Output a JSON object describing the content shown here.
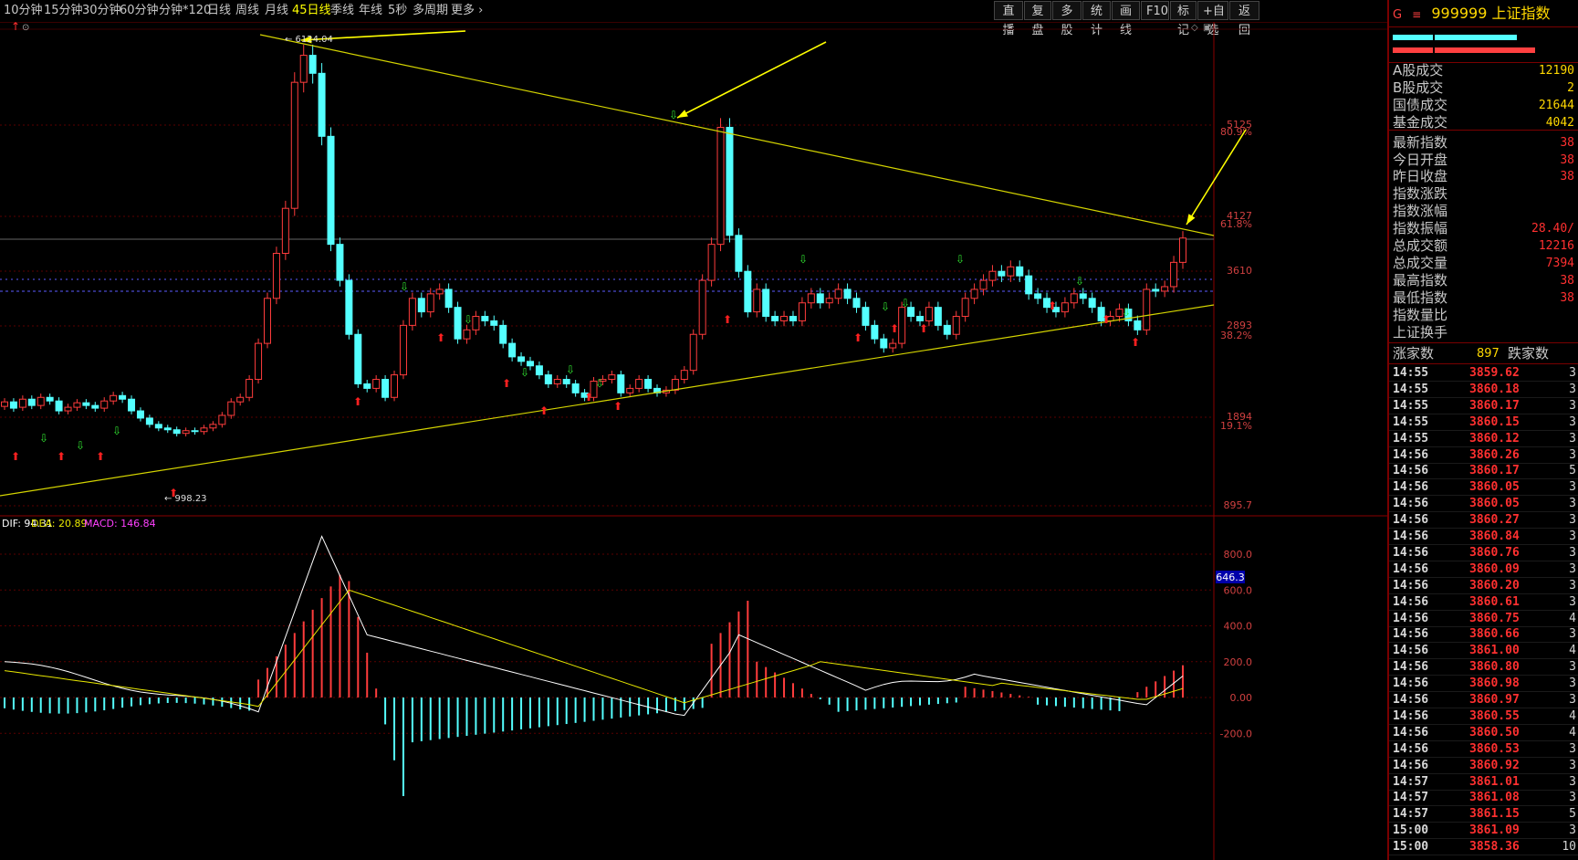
{
  "toolbar": {
    "periods": [
      "10分钟",
      "15分钟",
      "30分钟",
      "60分钟",
      "分钟*120",
      "日线",
      "周线",
      "月线",
      "45日线",
      "季线",
      "年线",
      "5秒",
      "多周期",
      "更多"
    ],
    "active_period": "45日线",
    "right_buttons": [
      "直播",
      "复盘",
      "多股",
      "统计",
      "画线",
      "F10",
      "标记",
      "+自选",
      "返回"
    ]
  },
  "chart": {
    "high_label": "6124.04",
    "low_label": "998.23",
    "price_axis": [
      "5125",
      "4127",
      "3610",
      "2893",
      "1894",
      "895.7"
    ],
    "pct_axis": [
      "80.9%",
      "61.8%",
      "38.2%",
      "19.1%"
    ],
    "macd_header": {
      "dif": "94.31",
      "dea_label": "DEA: 20.89",
      "macd_label": "MACD: 146.84"
    },
    "macd_axis": [
      "800.0",
      "600.0",
      "400.0",
      "200.0",
      "0.00",
      "-200.0"
    ],
    "macd_current": "646.3",
    "colors": {
      "up": "#ff3c3c",
      "down": "#54ffff",
      "trend": "#d4d400",
      "arrow": "#ffff00",
      "dif": "#ffffff",
      "dea": "#e8e800"
    }
  },
  "panel": {
    "code": "999999",
    "name": "上证指数",
    "g_label": "G",
    "stats": [
      {
        "label": "A股成交",
        "value": "12190"
      },
      {
        "label": "B股成交",
        "value": "2"
      },
      {
        "label": "国债成交",
        "value": "21644"
      },
      {
        "label": "基金成交",
        "value": "4042"
      },
      {
        "label": "最新指数",
        "value": "38"
      },
      {
        "label": "今日开盘",
        "value": "38"
      },
      {
        "label": "昨日收盘",
        "value": "38"
      },
      {
        "label": "指数涨跌",
        "value": ""
      },
      {
        "label": "指数涨幅",
        "value": ""
      },
      {
        "label": "指数振幅",
        "value": "28.40/"
      },
      {
        "label": "总成交额",
        "value": "12216"
      },
      {
        "label": "总成交量",
        "value": "7394"
      },
      {
        "label": "最高指数",
        "value": "38"
      },
      {
        "label": "最低指数",
        "value": "38"
      },
      {
        "label": "指数量比",
        "value": ""
      },
      {
        "label": "上证换手",
        "value": ""
      }
    ],
    "breadth": {
      "up_label": "涨家数",
      "up_count": "897",
      "down_label": "跌家数"
    },
    "ticks": [
      {
        "t": "14:55",
        "p": "3859.62",
        "v": "3"
      },
      {
        "t": "14:55",
        "p": "3860.18",
        "v": "3"
      },
      {
        "t": "14:55",
        "p": "3860.17",
        "v": "3"
      },
      {
        "t": "14:55",
        "p": "3860.15",
        "v": "3"
      },
      {
        "t": "14:55",
        "p": "3860.12",
        "v": "3"
      },
      {
        "t": "14:56",
        "p": "3860.26",
        "v": "3"
      },
      {
        "t": "14:56",
        "p": "3860.17",
        "v": "5"
      },
      {
        "t": "14:56",
        "p": "3860.05",
        "v": "3"
      },
      {
        "t": "14:56",
        "p": "3860.05",
        "v": "3"
      },
      {
        "t": "14:56",
        "p": "3860.27",
        "v": "3"
      },
      {
        "t": "14:56",
        "p": "3860.84",
        "v": "3"
      },
      {
        "t": "14:56",
        "p": "3860.76",
        "v": "3"
      },
      {
        "t": "14:56",
        "p": "3860.09",
        "v": "3"
      },
      {
        "t": "14:56",
        "p": "3860.20",
        "v": "3"
      },
      {
        "t": "14:56",
        "p": "3860.61",
        "v": "3"
      },
      {
        "t": "14:56",
        "p": "3860.75",
        "v": "4"
      },
      {
        "t": "14:56",
        "p": "3860.66",
        "v": "3"
      },
      {
        "t": "14:56",
        "p": "3861.00",
        "v": "4"
      },
      {
        "t": "14:56",
        "p": "3860.80",
        "v": "3"
      },
      {
        "t": "14:56",
        "p": "3860.98",
        "v": "3"
      },
      {
        "t": "14:56",
        "p": "3860.97",
        "v": "3"
      },
      {
        "t": "14:56",
        "p": "3860.55",
        "v": "4"
      },
      {
        "t": "14:56",
        "p": "3860.50",
        "v": "4"
      },
      {
        "t": "14:56",
        "p": "3860.53",
        "v": "3"
      },
      {
        "t": "14:56",
        "p": "3860.92",
        "v": "3"
      },
      {
        "t": "14:57",
        "p": "3861.01",
        "v": "3"
      },
      {
        "t": "14:57",
        "p": "3861.08",
        "v": "3"
      },
      {
        "t": "14:57",
        "p": "3861.15",
        "v": "5"
      },
      {
        "t": "15:00",
        "p": "3861.09",
        "v": "3"
      },
      {
        "t": "15:00",
        "p": "3858.36",
        "v": "10"
      }
    ]
  }
}
